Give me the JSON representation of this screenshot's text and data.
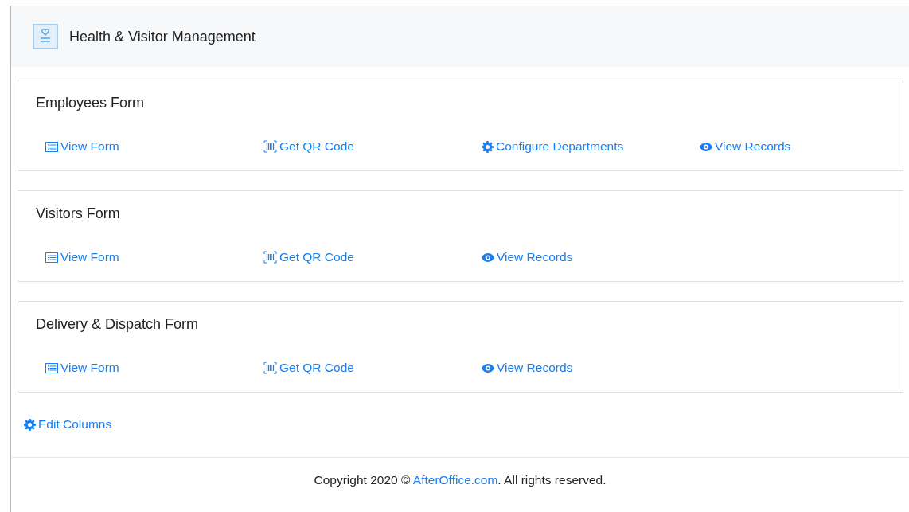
{
  "header": {
    "title": "Health & Visitor Management"
  },
  "forms": [
    {
      "title": "Employees Form",
      "links": [
        {
          "kind": "form",
          "label": "View Form"
        },
        {
          "kind": "qr",
          "label": "Get QR Code"
        },
        {
          "kind": "gear",
          "label": "Configure Departments"
        },
        {
          "kind": "eye",
          "label": "View Records"
        }
      ]
    },
    {
      "title": "Visitors Form",
      "links": [
        {
          "kind": "form",
          "label": "View Form"
        },
        {
          "kind": "qr",
          "label": "Get QR Code"
        },
        {
          "kind": "eye",
          "label": "View Records"
        }
      ]
    },
    {
      "title": "Delivery & Dispatch Form",
      "links": [
        {
          "kind": "form",
          "label": "View Form"
        },
        {
          "kind": "qr",
          "label": "Get QR Code"
        },
        {
          "kind": "eye",
          "label": "View Records"
        }
      ]
    }
  ],
  "edit_columns": {
    "label": "Edit Columns"
  },
  "footer": {
    "before": "Copyright 2020 © ",
    "link": "AfterOffice.com",
    "after": ". All rights reserved."
  }
}
